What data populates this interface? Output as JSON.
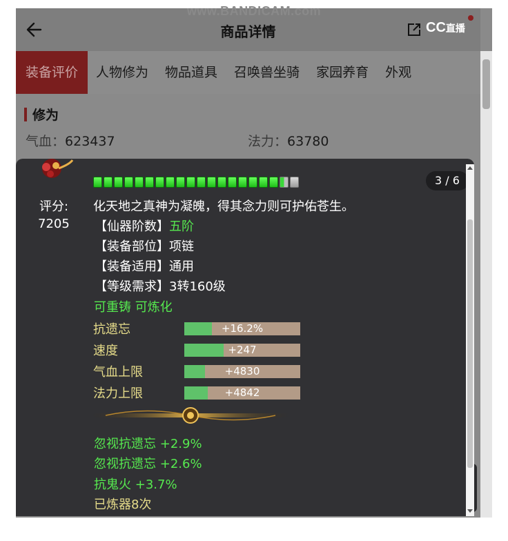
{
  "watermark": "www.BANDICAM.com",
  "header": {
    "title": "商品详情",
    "logo_text": "CC",
    "logo_suffix": "直播"
  },
  "tabs": [
    {
      "label": "装备评价",
      "active": true
    },
    {
      "label": "人物修为",
      "active": false
    },
    {
      "label": "物品道具",
      "active": false
    },
    {
      "label": "召唤兽坐骑",
      "active": false
    },
    {
      "label": "家园养育",
      "active": false
    },
    {
      "label": "外观",
      "active": false
    }
  ],
  "cultivation": {
    "section_title": "修为",
    "hp_label": "气血：",
    "hp_value": "623437",
    "mp_label": "法力：",
    "mp_value": "63780"
  },
  "tooltip": {
    "page_indicator": "3 / 6",
    "gem_level": {
      "filled": 18,
      "partial": 1,
      "empty": 1
    },
    "score_label": "评分:",
    "score_value": "7205",
    "description": "化天地之真神为凝魄，得其念力则可护佑苍生。",
    "attributes": [
      {
        "label": "【仙器阶数】",
        "value": "五阶",
        "value_color": "green"
      },
      {
        "label": "【装备部位】",
        "value": "项链",
        "value_color": "white"
      },
      {
        "label": "【装备适用】",
        "value": "通用",
        "value_color": "white"
      },
      {
        "label": "【等级需求】",
        "value": "3转160级",
        "value_color": "white"
      }
    ],
    "craft_note": "可重铸 可炼化",
    "stat_bars": [
      {
        "label": "抗遗忘",
        "value": "+16.2%",
        "fill": 0.24
      },
      {
        "label": "速度",
        "value": "+247",
        "fill": 0.34
      },
      {
        "label": "气血上限",
        "value": "+4830",
        "fill": 0.18
      },
      {
        "label": "法力上限",
        "value": "+4842",
        "fill": 0.2
      }
    ],
    "extra_attrs": [
      {
        "label": "忽视抗遗忘",
        "value": "+2.9%"
      },
      {
        "label": "忽视抗遗忘",
        "value": "+2.6%"
      },
      {
        "label": "抗鬼火",
        "value": "+3.7%"
      }
    ],
    "refine_count": "已炼器8次"
  },
  "colors": {
    "accent_red": "#7a1e1e",
    "stat_green": "#56e94f",
    "stat_yellow": "#e6dc8a",
    "tooltip_bg": "#313134"
  }
}
